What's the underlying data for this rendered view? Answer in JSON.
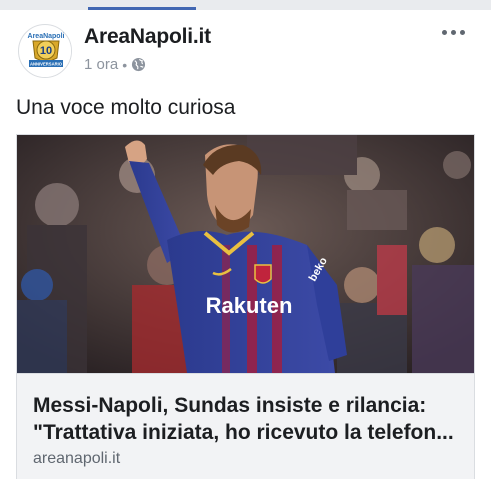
{
  "post": {
    "page_name": "AreaNapoli.it",
    "time": "1 ora",
    "separator": "•",
    "privacy_icon": "globe-icon",
    "more_icon": "more-horizontal-icon",
    "message": "Una voce molto curiosa",
    "avatar": {
      "brand": "AreaNapoli",
      "number": "10",
      "ribbon": "ANNIVERSARIO"
    }
  },
  "link_card": {
    "headline_line1": "Messi-Napoli, Sundas insiste e rilancia:",
    "headline_line2": "\"Trattativa iniziata, ho ricevuto la telefon...",
    "domain": "areanapoli.it",
    "photo": {
      "jersey_sponsor": "Rakuten",
      "jersey_brand": "beko"
    }
  },
  "colors": {
    "brand_blue": "#4267b2",
    "jersey_blue": "#2d3a8c",
    "jersey_red": "#a51d3c",
    "text_secondary": "#8d949e"
  }
}
